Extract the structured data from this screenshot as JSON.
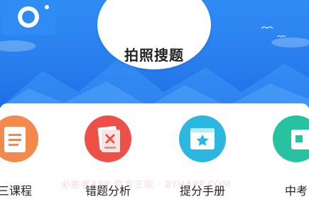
{
  "hero": {
    "label": "拍照搜题",
    "icon": "camera-icon",
    "colors": {
      "top": "#2f8cf5",
      "bottom": "#1f6fe6"
    }
  },
  "features": [
    {
      "label": "三课程",
      "icon": "document-icon",
      "color": "#f3894c"
    },
    {
      "label": "错题分析",
      "icon": "wrong-question-icon",
      "color": "#ee5048"
    },
    {
      "label": "提分手册",
      "icon": "star-book-icon",
      "color": "#2bb7e0"
    },
    {
      "label": "中考",
      "icon": "green-card-icon",
      "color": "#27c3a0"
    }
  ],
  "watermark": "必胜客APP 官方正版 · BYHAPP.COM"
}
